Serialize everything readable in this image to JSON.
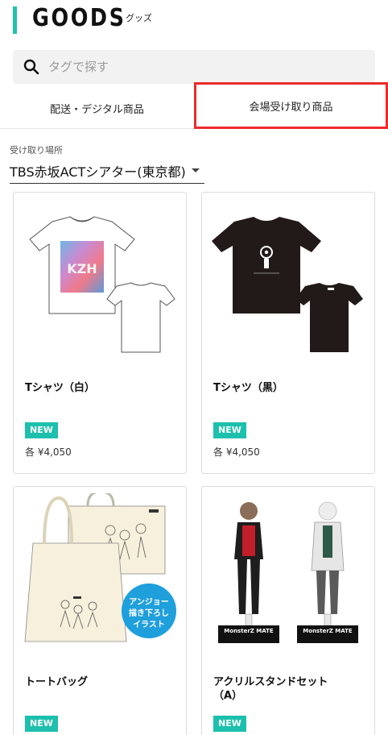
{
  "header": {
    "title": "GOODS",
    "subtitle": "グッズ"
  },
  "search": {
    "placeholder": "タグで探す"
  },
  "tabs": [
    {
      "label": "配送・デジタル商品"
    },
    {
      "label": "会場受け取り商品"
    }
  ],
  "venue": {
    "label": "受け取り場所",
    "selected": "TBS赤坂ACTシアター(東京都)"
  },
  "products": [
    {
      "name": "Tシャツ（白）",
      "badge": "NEW",
      "price": "各 ¥4,050"
    },
    {
      "name": "Tシャツ（黒）",
      "badge": "NEW",
      "price": "各 ¥4,050"
    },
    {
      "name": "トートバッグ",
      "badge": "NEW",
      "price": ""
    },
    {
      "name": "アクリルスタンドセット（A）",
      "badge": "NEW",
      "price": ""
    }
  ],
  "tote_bubble": {
    "line1": "アンジョー",
    "line2": "描き下ろし",
    "line3": "イラスト"
  },
  "stand_logo": {
    "text": "MonsterZ MATE"
  },
  "colors": {
    "accent": "#22c2ad",
    "badge": "#1cc0ac",
    "highlight_border": "#ec2b2b",
    "bubble": "#1f9fdc"
  }
}
